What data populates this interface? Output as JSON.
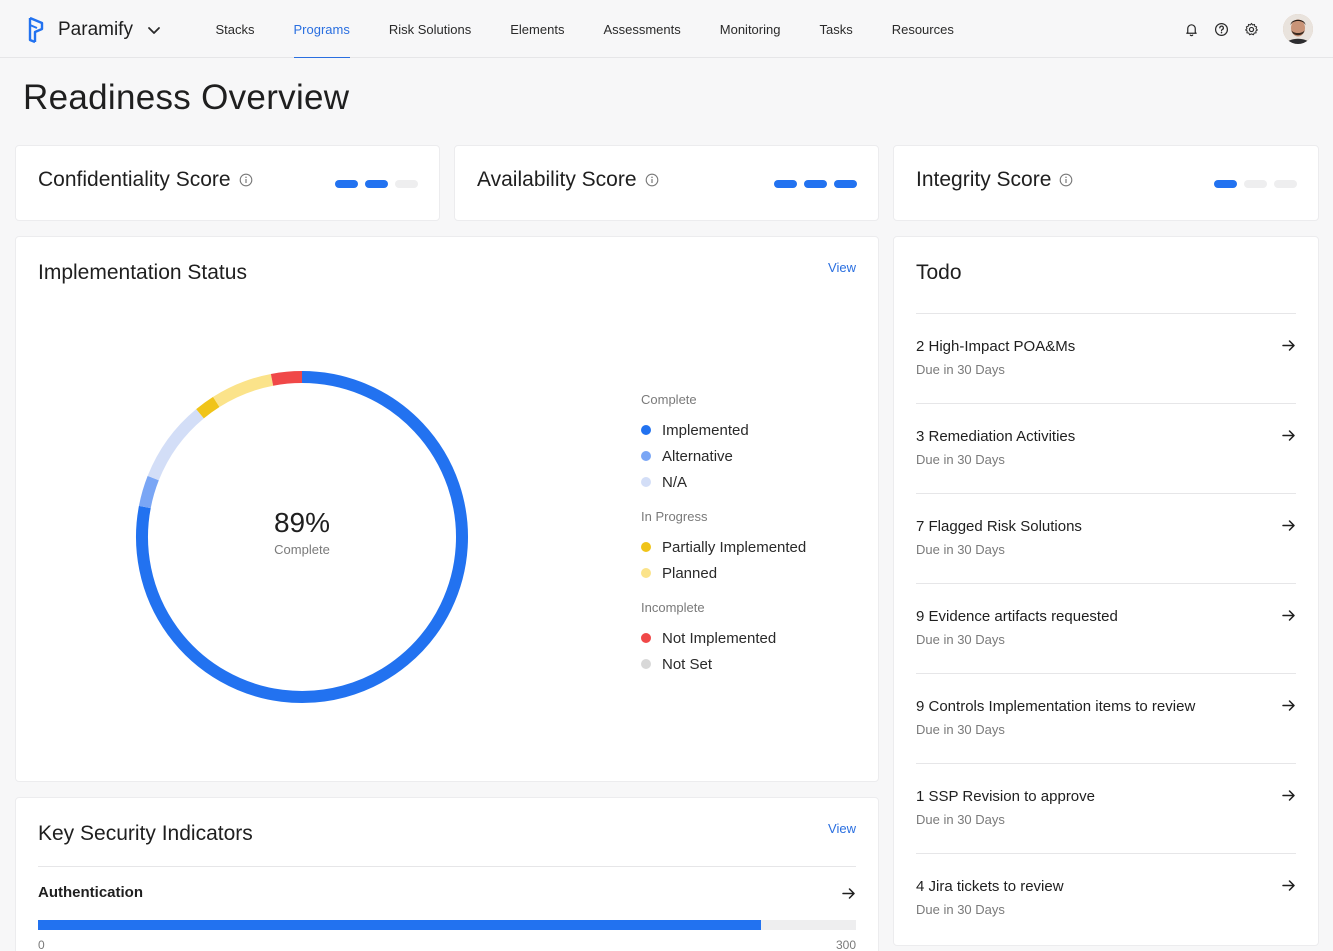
{
  "brand": {
    "name": "Paramify"
  },
  "nav": {
    "items": [
      {
        "label": "Stacks"
      },
      {
        "label": "Programs",
        "active": true
      },
      {
        "label": "Risk Solutions"
      },
      {
        "label": "Elements"
      },
      {
        "label": "Assessments"
      },
      {
        "label": "Monitoring"
      },
      {
        "label": "Tasks"
      },
      {
        "label": "Resources"
      }
    ],
    "icons": [
      "bell-icon",
      "help-icon",
      "gear-icon",
      "avatar"
    ]
  },
  "page": {
    "title": "Readiness Overview"
  },
  "scores": [
    {
      "title": "Confidentiality Score",
      "level": 2,
      "max": 3
    },
    {
      "title": "Availability Score",
      "level": 3,
      "max": 3
    },
    {
      "title": "Integrity Score",
      "level": 1,
      "max": 3
    }
  ],
  "implementation": {
    "title": "Implementation Status",
    "view_label": "View",
    "center_value": "89%",
    "center_label": "Complete",
    "legend": [
      {
        "group": "Complete",
        "items": [
          {
            "label": "Implemented",
            "color": "#2272f0"
          },
          {
            "label": "Alternative",
            "color": "#7aa6f5"
          },
          {
            "label": "N/A",
            "color": "#d3def7"
          }
        ]
      },
      {
        "group": "In Progress",
        "items": [
          {
            "label": "Partially Implemented",
            "color": "#f0c419"
          },
          {
            "label": "Planned",
            "color": "#fbe38a"
          }
        ]
      },
      {
        "group": "Incomplete",
        "items": [
          {
            "label": "Not Implemented",
            "color": "#f04848"
          },
          {
            "label": "Not Set",
            "color": "#d8d8d8"
          }
        ]
      }
    ]
  },
  "chart_data": {
    "type": "pie",
    "style": "donut",
    "categories": [
      "Implemented",
      "Alternative",
      "N/A",
      "Partially Implemented",
      "Planned",
      "Not Implemented"
    ],
    "values": [
      78,
      3,
      8,
      2,
      6,
      3
    ],
    "colors": [
      "#2272f0",
      "#7aa6f5",
      "#d3def7",
      "#f0c419",
      "#fbe38a",
      "#f04848"
    ],
    "title": "Implementation Status"
  },
  "todo": {
    "title": "Todo",
    "items": [
      {
        "title": "2 High-Impact POA&Ms",
        "due": "Due in 30 Days"
      },
      {
        "title": "3 Remediation Activities",
        "due": "Due in 30 Days"
      },
      {
        "title": "7 Flagged Risk Solutions",
        "due": "Due in 30 Days"
      },
      {
        "title": "9 Evidence artifacts requested",
        "due": "Due in 30 Days"
      },
      {
        "title": "9 Controls Implementation items to review",
        "due": "Due in 30 Days"
      },
      {
        "title": "1 SSP Revision to approve",
        "due": "Due in 30 Days"
      },
      {
        "title": "4 Jira tickets to review",
        "due": "Due in 30 Days"
      }
    ]
  },
  "ksi": {
    "title": "Key Security Indicators",
    "view_label": "View",
    "items": [
      {
        "label": "Authentication",
        "value": 265,
        "min": "0",
        "max": "300"
      }
    ]
  }
}
